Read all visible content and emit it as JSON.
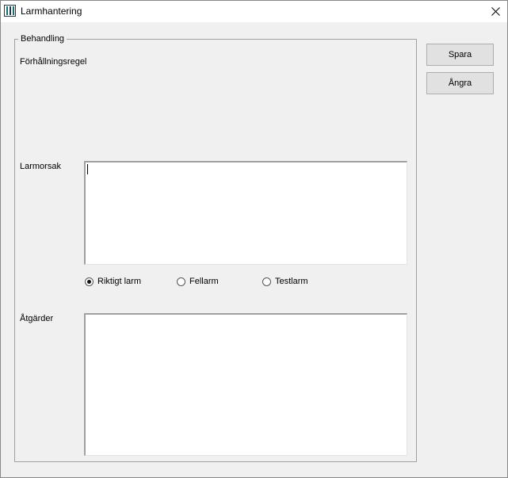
{
  "window": {
    "title": "Larmhantering"
  },
  "group": {
    "title": "Behandling",
    "rule_label": "Förhållningsregel",
    "cause_label": "Larmorsak",
    "cause_value": "",
    "actions_label": "Åtgärder",
    "actions_value": ""
  },
  "radios": [
    {
      "label": "Riktigt larm",
      "checked": true
    },
    {
      "label": "Fellarm",
      "checked": false
    },
    {
      "label": "Testlarm",
      "checked": false
    }
  ],
  "buttons": {
    "save": "Spara",
    "undo": "Ångra"
  },
  "icons": {
    "app": "app-icon",
    "close": "close-icon"
  }
}
